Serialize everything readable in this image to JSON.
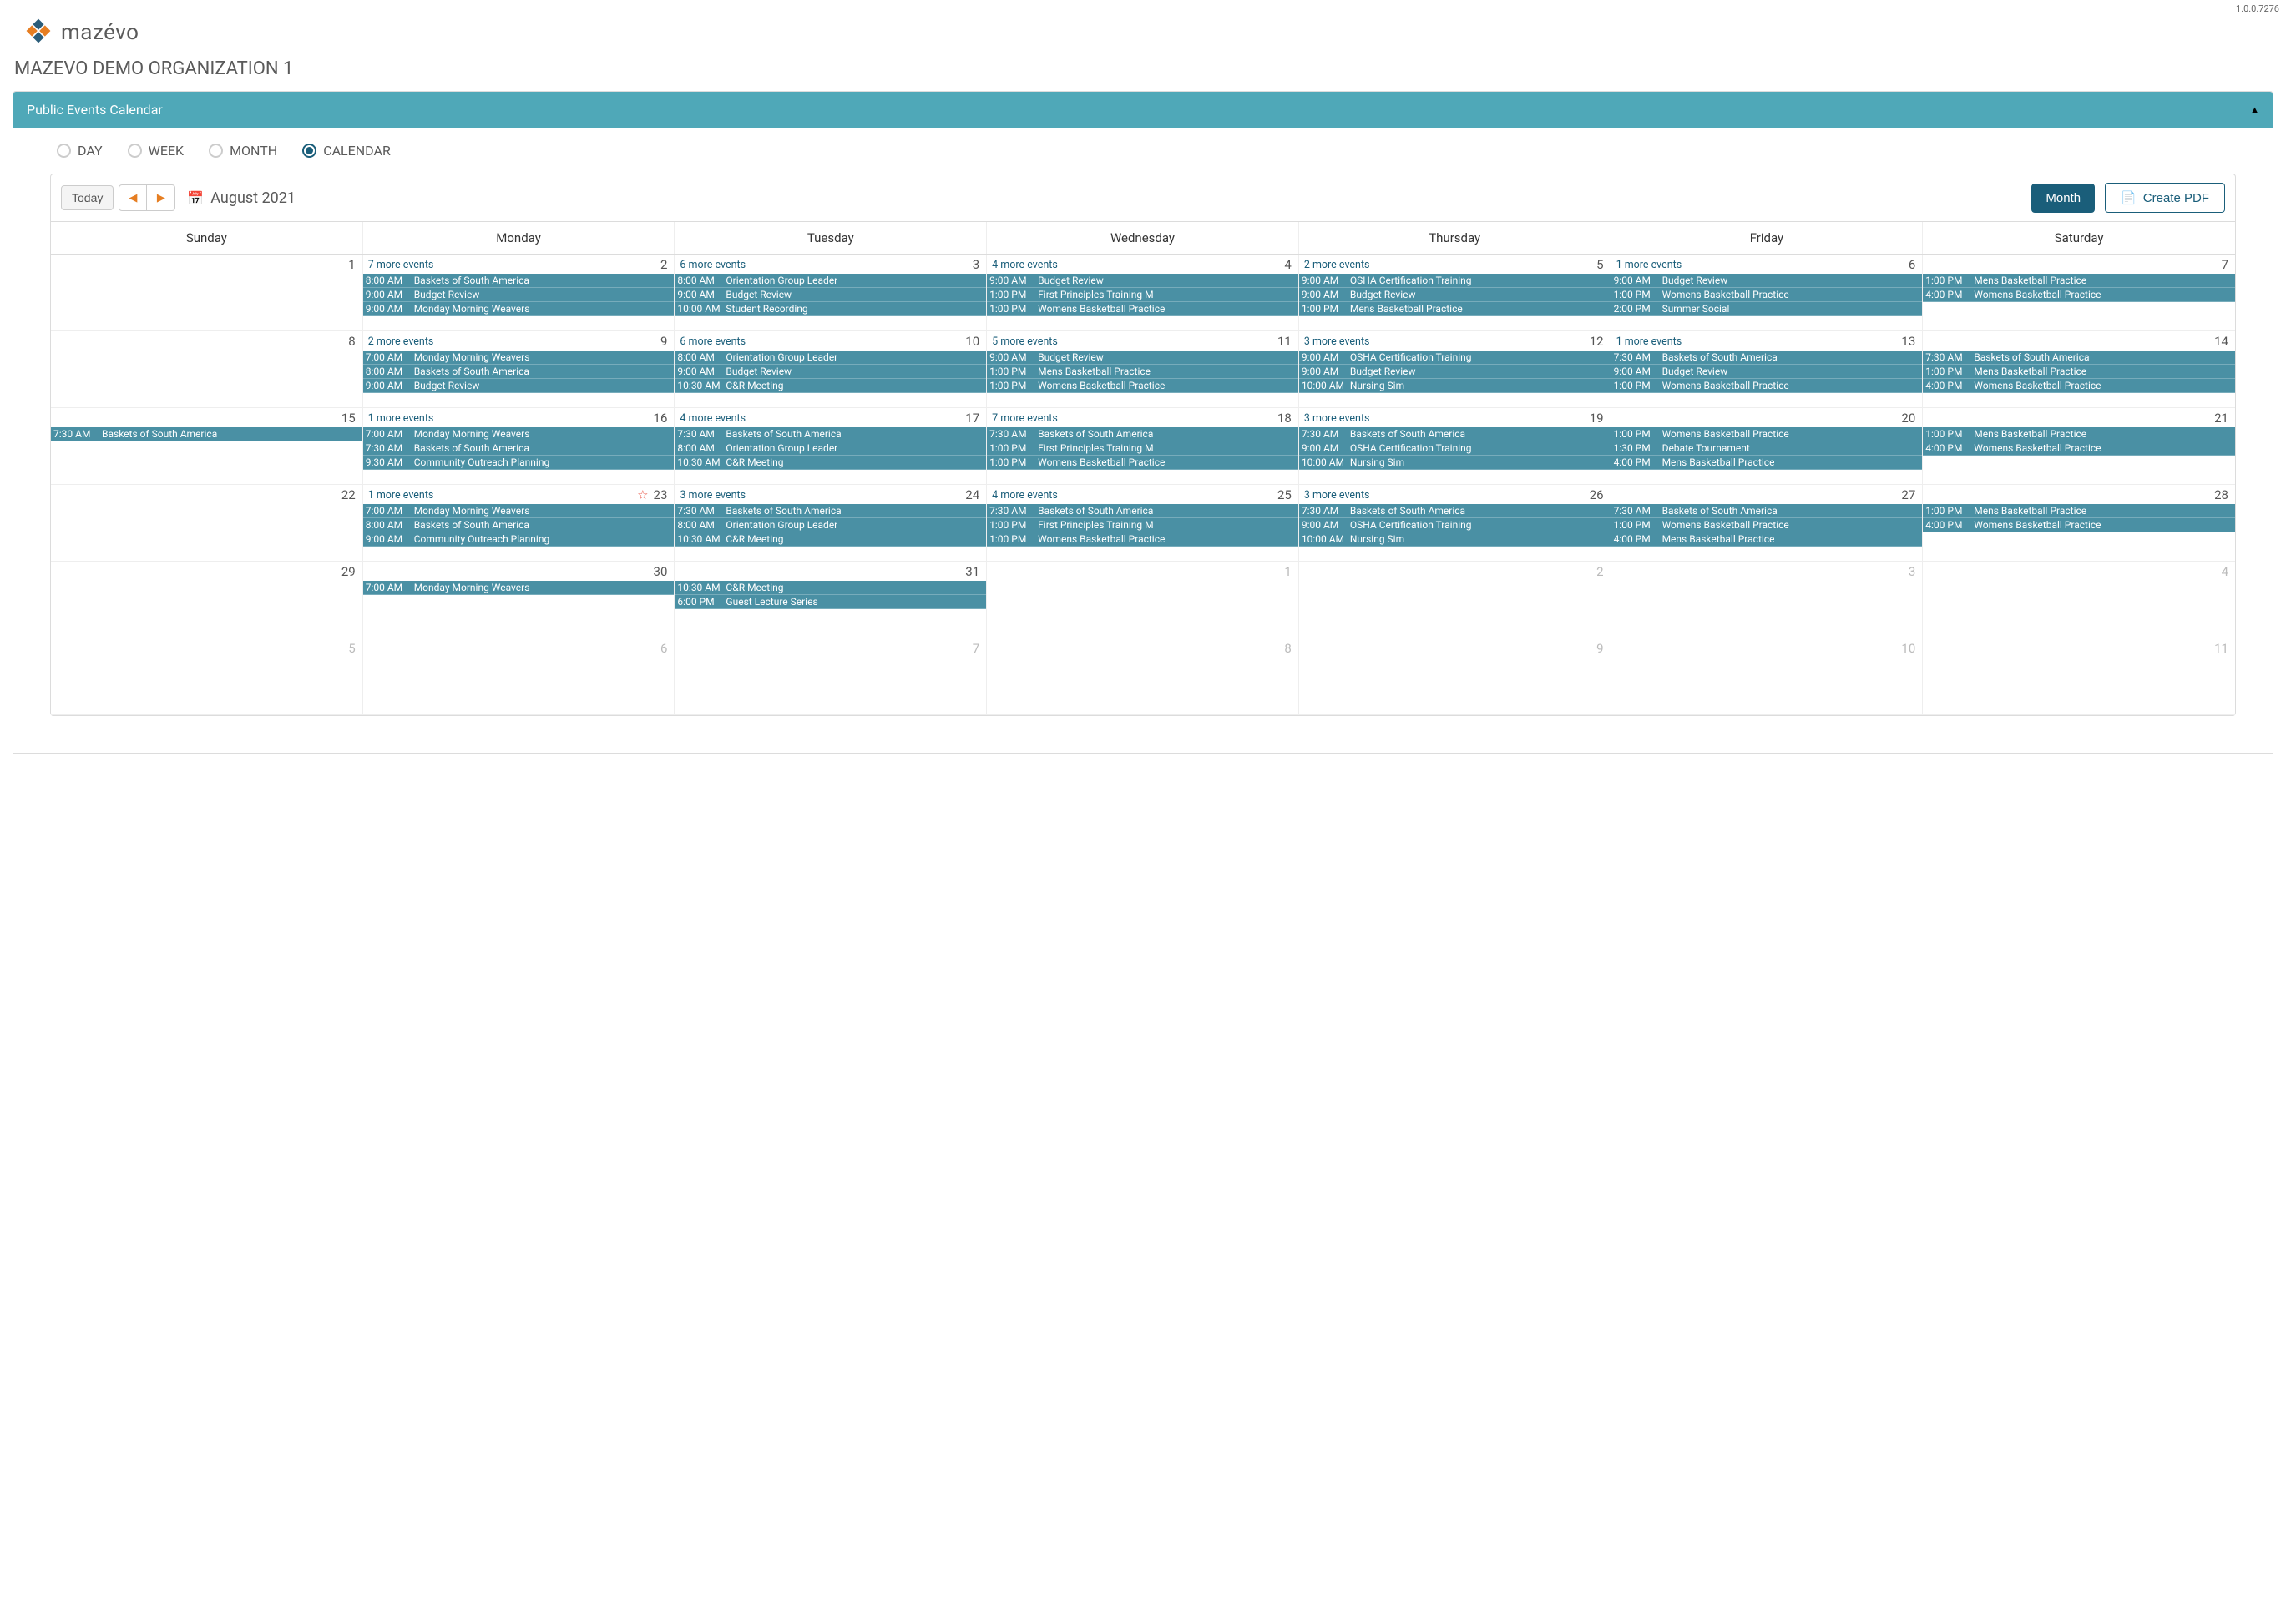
{
  "version": "1.0.0.7276",
  "brand": "mazévo",
  "orgName": "MAZEVO DEMO ORGANIZATION 1",
  "panelTitle": "Public Events Calendar",
  "views": {
    "day": "DAY",
    "week": "WEEK",
    "month": "MONTH",
    "calendar": "CALENDAR",
    "selected": "calendar"
  },
  "toolbar": {
    "today": "Today",
    "monthLabel": "August 2021",
    "viewButton": "Month",
    "pdfButton": "Create PDF"
  },
  "dayHeaders": [
    "Sunday",
    "Monday",
    "Tuesday",
    "Wednesday",
    "Thursday",
    "Friday",
    "Saturday"
  ],
  "weeks": [
    [
      {
        "date": "1"
      },
      {
        "date": "2",
        "more": "7 more events",
        "events": [
          [
            "8:00 AM",
            "Baskets of South America"
          ],
          [
            "9:00 AM",
            "Budget Review"
          ],
          [
            "9:00 AM",
            "Monday Morning Weavers"
          ]
        ]
      },
      {
        "date": "3",
        "more": "6 more events",
        "events": [
          [
            "8:00 AM",
            "Orientation Group Leader"
          ],
          [
            "9:00 AM",
            "Budget Review"
          ],
          [
            "10:00 AM",
            "Student Recording"
          ]
        ]
      },
      {
        "date": "4",
        "more": "4 more events",
        "events": [
          [
            "9:00 AM",
            "Budget Review"
          ],
          [
            "1:00 PM",
            "First Principles Training M"
          ],
          [
            "1:00 PM",
            "Womens Basketball Practice"
          ]
        ]
      },
      {
        "date": "5",
        "more": "2 more events",
        "events": [
          [
            "9:00 AM",
            "OSHA Certification Training"
          ],
          [
            "9:00 AM",
            "Budget Review"
          ],
          [
            "1:00 PM",
            "Mens Basketball Practice"
          ]
        ]
      },
      {
        "date": "6",
        "more": "1 more events",
        "events": [
          [
            "9:00 AM",
            "Budget Review"
          ],
          [
            "1:00 PM",
            "Womens Basketball Practice"
          ],
          [
            "2:00 PM",
            "Summer Social"
          ]
        ]
      },
      {
        "date": "7",
        "events": [
          [
            "1:00 PM",
            "Mens Basketball Practice"
          ],
          [
            "4:00 PM",
            "Womens Basketball Practice"
          ]
        ]
      }
    ],
    [
      {
        "date": "8"
      },
      {
        "date": "9",
        "more": "2 more events",
        "events": [
          [
            "7:00 AM",
            "Monday Morning Weavers"
          ],
          [
            "8:00 AM",
            "Baskets of South America"
          ],
          [
            "9:00 AM",
            "Budget Review"
          ]
        ]
      },
      {
        "date": "10",
        "more": "6 more events",
        "events": [
          [
            "8:00 AM",
            "Orientation Group Leader"
          ],
          [
            "9:00 AM",
            "Budget Review"
          ],
          [
            "10:30 AM",
            "C&R Meeting"
          ]
        ]
      },
      {
        "date": "11",
        "more": "5 more events",
        "events": [
          [
            "9:00 AM",
            "Budget Review"
          ],
          [
            "1:00 PM",
            "Mens Basketball Practice"
          ],
          [
            "1:00 PM",
            "Womens Basketball Practice"
          ]
        ]
      },
      {
        "date": "12",
        "more": "3 more events",
        "events": [
          [
            "9:00 AM",
            "OSHA Certification Training"
          ],
          [
            "9:00 AM",
            "Budget Review"
          ],
          [
            "10:00 AM",
            "Nursing Sim"
          ]
        ]
      },
      {
        "date": "13",
        "more": "1 more events",
        "events": [
          [
            "7:30 AM",
            "Baskets of South America"
          ],
          [
            "9:00 AM",
            "Budget Review"
          ],
          [
            "1:00 PM",
            "Womens Basketball Practice"
          ]
        ]
      },
      {
        "date": "14",
        "events": [
          [
            "7:30 AM",
            "Baskets of South America"
          ],
          [
            "1:00 PM",
            "Mens Basketball Practice"
          ],
          [
            "4:00 PM",
            "Womens Basketball Practice"
          ]
        ]
      }
    ],
    [
      {
        "date": "15",
        "events": [
          [
            "7:30 AM",
            "Baskets of South America"
          ]
        ]
      },
      {
        "date": "16",
        "more": "1 more events",
        "events": [
          [
            "7:00 AM",
            "Monday Morning Weavers"
          ],
          [
            "7:30 AM",
            "Baskets of South America"
          ],
          [
            "9:30 AM",
            "Community Outreach Planning"
          ]
        ]
      },
      {
        "date": "17",
        "more": "4 more events",
        "events": [
          [
            "7:30 AM",
            "Baskets of South America"
          ],
          [
            "8:00 AM",
            "Orientation Group Leader"
          ],
          [
            "10:30 AM",
            "C&R Meeting"
          ]
        ]
      },
      {
        "date": "18",
        "more": "7 more events",
        "events": [
          [
            "7:30 AM",
            "Baskets of South America"
          ],
          [
            "1:00 PM",
            "First Principles Training M"
          ],
          [
            "1:00 PM",
            "Womens Basketball Practice"
          ]
        ]
      },
      {
        "date": "19",
        "more": "3 more events",
        "events": [
          [
            "7:30 AM",
            "Baskets of South America"
          ],
          [
            "9:00 AM",
            "OSHA Certification Training"
          ],
          [
            "10:00 AM",
            "Nursing Sim"
          ]
        ]
      },
      {
        "date": "20",
        "events": [
          [
            "1:00 PM",
            "Womens Basketball Practice"
          ],
          [
            "1:30 PM",
            "Debate Tournament"
          ],
          [
            "4:00 PM",
            "Mens Basketball Practice"
          ]
        ]
      },
      {
        "date": "21",
        "events": [
          [
            "1:00 PM",
            "Mens Basketball Practice"
          ],
          [
            "4:00 PM",
            "Womens Basketball Practice"
          ]
        ]
      }
    ],
    [
      {
        "date": "22"
      },
      {
        "date": "23",
        "more": "1 more events",
        "star": true,
        "events": [
          [
            "7:00 AM",
            "Monday Morning Weavers"
          ],
          [
            "8:00 AM",
            "Baskets of South America"
          ],
          [
            "9:00 AM",
            "Community Outreach Planning"
          ]
        ]
      },
      {
        "date": "24",
        "more": "3 more events",
        "events": [
          [
            "7:30 AM",
            "Baskets of South America"
          ],
          [
            "8:00 AM",
            "Orientation Group Leader"
          ],
          [
            "10:30 AM",
            "C&R Meeting"
          ]
        ]
      },
      {
        "date": "25",
        "more": "4 more events",
        "events": [
          [
            "7:30 AM",
            "Baskets of South America"
          ],
          [
            "1:00 PM",
            "First Principles Training M"
          ],
          [
            "1:00 PM",
            "Womens Basketball Practice"
          ]
        ]
      },
      {
        "date": "26",
        "more": "3 more events",
        "events": [
          [
            "7:30 AM",
            "Baskets of South America"
          ],
          [
            "9:00 AM",
            "OSHA Certification Training"
          ],
          [
            "10:00 AM",
            "Nursing Sim"
          ]
        ]
      },
      {
        "date": "27",
        "events": [
          [
            "7:30 AM",
            "Baskets of South America"
          ],
          [
            "1:00 PM",
            "Womens Basketball Practice"
          ],
          [
            "4:00 PM",
            "Mens Basketball Practice"
          ]
        ]
      },
      {
        "date": "28",
        "events": [
          [
            "1:00 PM",
            "Mens Basketball Practice"
          ],
          [
            "4:00 PM",
            "Womens Basketball Practice"
          ]
        ]
      }
    ],
    [
      {
        "date": "29"
      },
      {
        "date": "30",
        "events": [
          [
            "7:00 AM",
            "Monday Morning Weavers"
          ]
        ]
      },
      {
        "date": "31",
        "events": [
          [
            "10:30 AM",
            "C&R Meeting"
          ],
          [
            "6:00 PM",
            "Guest Lecture Series"
          ]
        ]
      },
      {
        "date": "1",
        "otherMonth": true
      },
      {
        "date": "2",
        "otherMonth": true
      },
      {
        "date": "3",
        "otherMonth": true
      },
      {
        "date": "4",
        "otherMonth": true
      }
    ],
    [
      {
        "date": "5",
        "otherMonth": true
      },
      {
        "date": "6",
        "otherMonth": true
      },
      {
        "date": "7",
        "otherMonth": true
      },
      {
        "date": "8",
        "otherMonth": true
      },
      {
        "date": "9",
        "otherMonth": true
      },
      {
        "date": "10",
        "otherMonth": true
      },
      {
        "date": "11",
        "otherMonth": true
      }
    ]
  ]
}
